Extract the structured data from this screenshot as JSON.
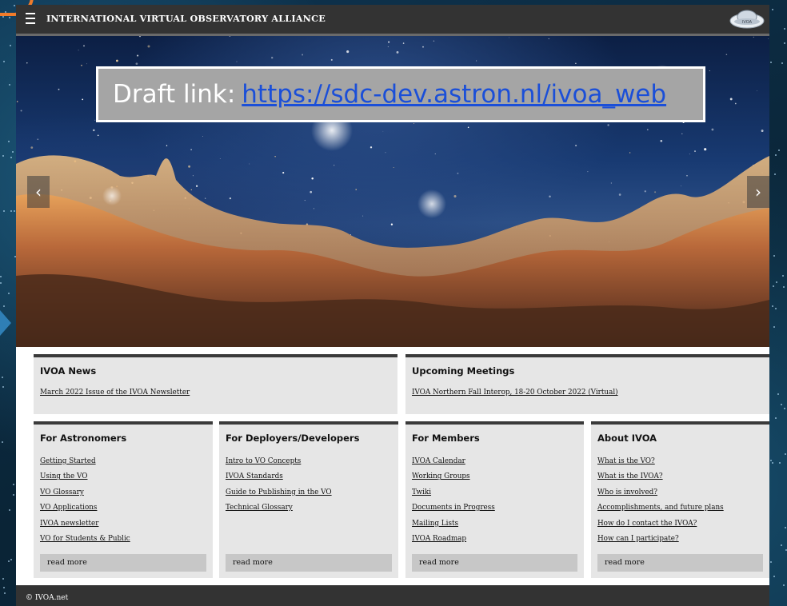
{
  "header": {
    "site_title": "INTERNATIONAL VIRTUAL OBSERVATORY ALLIANCE",
    "menu_icon": "hamburger-icon",
    "logo": "ivoa-logo",
    "logo_text": "IVOA"
  },
  "hero": {
    "draft_label": "Draft link:",
    "draft_url": "https://sdc-dev.astron.nl/ivoa_web",
    "prev_icon": "‹",
    "next_icon": "›"
  },
  "news": {
    "title": "IVOA News",
    "item": "March 2022 Issue of the IVOA Newsletter"
  },
  "meetings": {
    "title": "Upcoming Meetings",
    "item": "IVOA Northern Fall Interop, 18-20 October 2022 (Virtual)"
  },
  "sections": [
    {
      "title": "For Astronomers",
      "links": [
        "Getting Started",
        "Using the VO",
        "VO Glossary",
        "VO Applications",
        "IVOA newsletter",
        "VO for Students & Public"
      ],
      "read_more": "read more"
    },
    {
      "title": "For Deployers/Developers",
      "links": [
        "Intro to VO Concepts",
        "IVOA Standards",
        "Guide to Publishing in the VO",
        "Technical Glossary"
      ],
      "read_more": "read more"
    },
    {
      "title": "For Members",
      "links": [
        "IVOA Calendar",
        "Working Groups",
        "Twiki",
        "Documents in Progress",
        "Mailing Lists",
        "IVOA Roadmap"
      ],
      "read_more": "read more"
    },
    {
      "title": "About IVOA",
      "links": [
        "What is the VO?",
        "What is the IVOA?",
        "Who is involved?",
        "Accomplishments, and future plans",
        "How do I contact the IVOA?",
        "How can I participate?"
      ],
      "read_more": "read more"
    }
  ],
  "footer": {
    "copyright": "© IVOA.net"
  },
  "colors": {
    "topbar": "#333333",
    "card": "#e6e6e6",
    "card_border": "#3a3a3a",
    "draft_box": "#a5a5a5",
    "link_blue": "#1b4fd8"
  }
}
